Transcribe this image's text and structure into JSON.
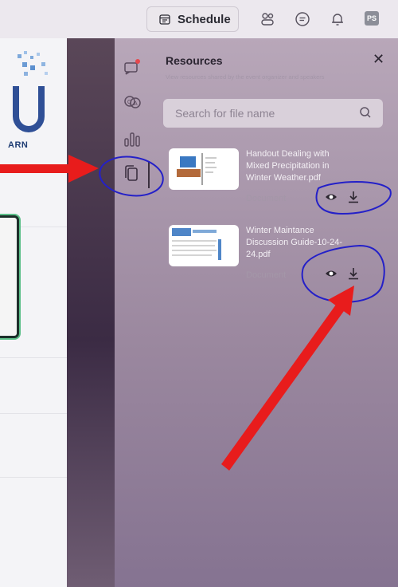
{
  "topbar": {
    "schedule_label": "Schedule",
    "avatar_initials": "PS"
  },
  "logo": {
    "text": "ARN"
  },
  "resources": {
    "title": "Resources",
    "subtitle": "View resources shared by the event organizer and speakers",
    "search_placeholder": "Search for file name",
    "items": [
      {
        "name": "Handout Dealing with Mixed Precipitation in Winter Weather.pdf",
        "type": "Document"
      },
      {
        "name": "Winter Maintance Discussion Guide-10-24-24.pdf",
        "type": "Document"
      }
    ]
  },
  "colors": {
    "annotation_red": "#e81c1c",
    "annotation_blue": "#2420c8",
    "panel_bg": "#a290a6"
  }
}
